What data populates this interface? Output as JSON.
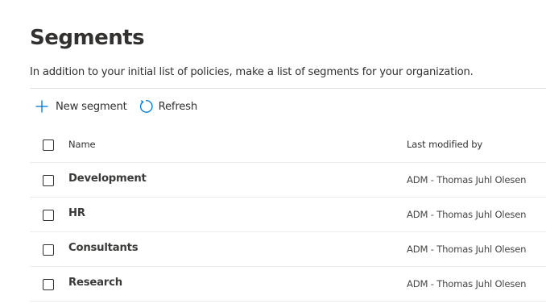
{
  "page": {
    "title": "Segments",
    "description": "In addition to your initial list of policies, make a list of segments for your organization."
  },
  "toolbar": {
    "new_label": "New segment",
    "new_icon": "plus-icon",
    "refresh_label": "Refresh",
    "refresh_icon": "refresh-icon"
  },
  "table": {
    "columns": {
      "name": "Name",
      "modified_by": "Last modified by"
    },
    "rows": [
      {
        "name": "Development",
        "modified_by": "ADM - Thomas Juhl Olesen"
      },
      {
        "name": "HR",
        "modified_by": "ADM - Thomas Juhl Olesen"
      },
      {
        "name": "Consultants",
        "modified_by": "ADM - Thomas Juhl Olesen"
      },
      {
        "name": "Research",
        "modified_by": "ADM - Thomas Juhl Olesen"
      }
    ]
  },
  "colors": {
    "accent": "#0078d4",
    "text": "#323130",
    "divider": "#edebe9"
  }
}
